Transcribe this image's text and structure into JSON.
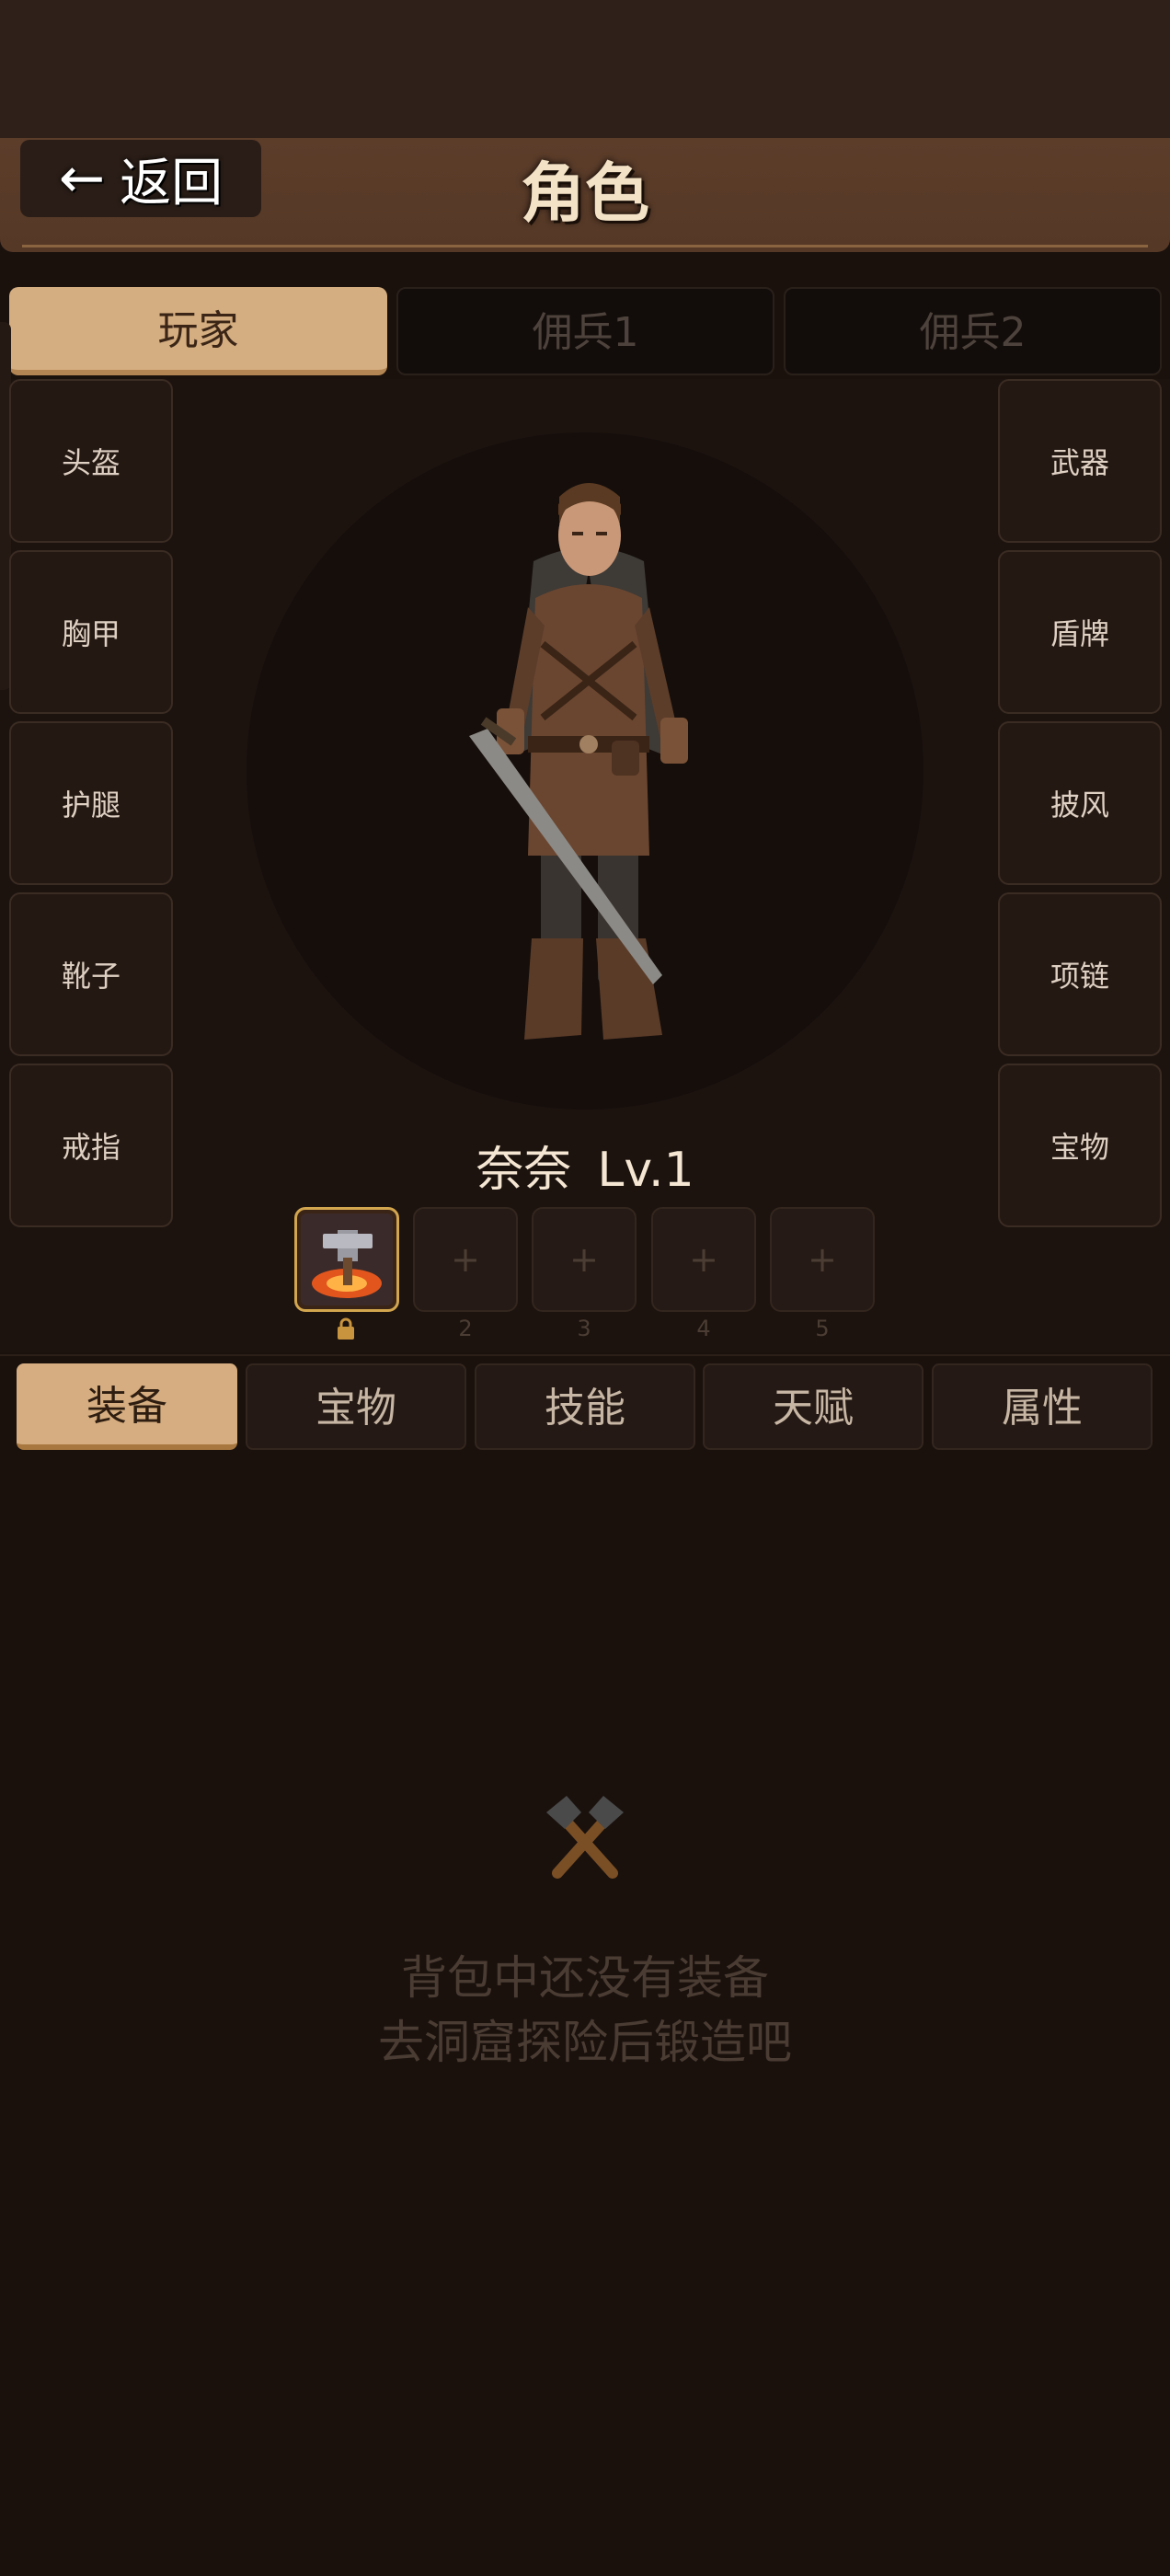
{
  "header": {
    "back_label": "返回",
    "title": "角色"
  },
  "top_tabs": [
    {
      "label": "玩家",
      "active": true
    },
    {
      "label": "佣兵1",
      "active": false
    },
    {
      "label": "佣兵2",
      "active": false
    }
  ],
  "equipment_slots": {
    "left": [
      "头盔",
      "胸甲",
      "护腿",
      "靴子",
      "戒指"
    ],
    "right": [
      "武器",
      "盾牌",
      "披风",
      "项链",
      "宝物"
    ]
  },
  "hero": {
    "name": "奈奈",
    "level": "Lv.1"
  },
  "skill_slots": {
    "empty_symbol": "+",
    "indices": [
      "2",
      "3",
      "4",
      "5"
    ],
    "first_slot_icon": "hammer-fire-icon",
    "first_slot_locked": true
  },
  "bottom_tabs": [
    {
      "label": "装备",
      "active": true
    },
    {
      "label": "宝物",
      "active": false
    },
    {
      "label": "技能",
      "active": false
    },
    {
      "label": "天赋",
      "active": false
    },
    {
      "label": "属性",
      "active": false
    }
  ],
  "empty_state": {
    "icon": "crossed-hammers-icon",
    "line1": "背包中还没有装备",
    "line2": "去洞窟探险后锻造吧"
  },
  "colors": {
    "background": "#1a110d",
    "header": "#5a3b28",
    "accent_tab": "#d4ad80",
    "gold_border": "#d2a54f"
  }
}
